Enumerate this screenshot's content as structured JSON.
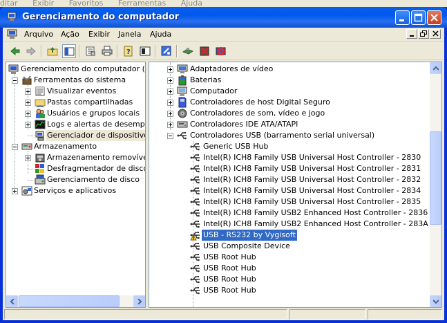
{
  "background_menu": [
    "ditar",
    "Exibir",
    "Favoritos",
    "Ferramentas",
    "Ajuda"
  ],
  "window": {
    "title": "Gerenciamento do computador",
    "colors": {
      "titlebar": "#0058ee",
      "selection": "#316ac5",
      "close": "#c4401f"
    }
  },
  "menubar": {
    "items": [
      "Arquivo",
      "Ação",
      "Exibir",
      "Janela",
      "Ajuda"
    ]
  },
  "toolbar": {
    "icons": [
      "back-arrow-icon",
      "forward-arrow-icon",
      "up-folder-icon",
      "show-tree-icon",
      "properties-icon",
      "print-icon",
      "help-icon",
      "console-icon",
      "scan-hardware-icon",
      "update-driver-icon",
      "uninstall-icon",
      "disable-icon"
    ]
  },
  "left_tree": {
    "items": [
      {
        "label": "Gerenciamento do computador (loca",
        "icon": "computer-management-icon",
        "level": 0,
        "expander": "none"
      },
      {
        "label": "Ferramentas do sistema",
        "icon": "tools-icon",
        "level": 1,
        "expander": "minus"
      },
      {
        "label": "Visualizar eventos",
        "icon": "event-viewer-icon",
        "level": 2,
        "expander": "plus"
      },
      {
        "label": "Pastas compartilhadas",
        "icon": "shared-folder-icon",
        "level": 2,
        "expander": "plus"
      },
      {
        "label": "Usuários e grupos locais",
        "icon": "users-icon",
        "level": 2,
        "expander": "plus"
      },
      {
        "label": "Logs e alertas de desempen",
        "icon": "performance-logs-icon",
        "level": 2,
        "expander": "plus"
      },
      {
        "label": "Gerenciador de dispositivos",
        "icon": "device-manager-icon",
        "level": 2,
        "expander": "none",
        "selected": true
      },
      {
        "label": "Armazenamento",
        "icon": "storage-icon",
        "level": 1,
        "expander": "minus"
      },
      {
        "label": "Armazenamento removível",
        "icon": "removable-storage-icon",
        "level": 2,
        "expander": "plus"
      },
      {
        "label": "Desfragmentador de disco",
        "icon": "defrag-icon",
        "level": 2,
        "expander": "none"
      },
      {
        "label": "Gerenciamento de disco",
        "icon": "disk-management-icon",
        "level": 2,
        "expander": "none"
      },
      {
        "label": "Serviços e aplicativos",
        "icon": "services-icon",
        "level": 1,
        "expander": "plus"
      }
    ]
  },
  "right_tree": {
    "items": [
      {
        "label": "Adaptadores de vídeo",
        "icon": "display-adapter-icon",
        "level": 0,
        "expander": "plus"
      },
      {
        "label": "Baterias",
        "icon": "battery-icon",
        "level": 0,
        "expander": "plus"
      },
      {
        "label": "Computador",
        "icon": "computer-icon",
        "level": 0,
        "expander": "plus"
      },
      {
        "label": "Controladores de host Digital Seguro",
        "icon": "sd-host-icon",
        "level": 0,
        "expander": "plus"
      },
      {
        "label": "Controladores de som, vídeo e jogo",
        "icon": "sound-icon",
        "level": 0,
        "expander": "plus"
      },
      {
        "label": "Controladores IDE ATA/ATAPI",
        "icon": "ide-controller-icon",
        "level": 0,
        "expander": "plus"
      },
      {
        "label": "Controladores USB (barramento serial universal)",
        "icon": "usb-icon",
        "level": 0,
        "expander": "minus"
      },
      {
        "label": "Generic USB Hub",
        "icon": "usb-icon",
        "level": 1
      },
      {
        "label": "Intel(R) ICH8 Family USB Universal Host Controller - 2830",
        "icon": "usb-icon",
        "level": 1
      },
      {
        "label": "Intel(R) ICH8 Family USB Universal Host Controller - 2831",
        "icon": "usb-icon",
        "level": 1
      },
      {
        "label": "Intel(R) ICH8 Family USB Universal Host Controller - 2832",
        "icon": "usb-icon",
        "level": 1
      },
      {
        "label": "Intel(R) ICH8 Family USB Universal Host Controller - 2834",
        "icon": "usb-icon",
        "level": 1
      },
      {
        "label": "Intel(R) ICH8 Family USB Universal Host Controller - 2835",
        "icon": "usb-icon",
        "level": 1
      },
      {
        "label": "Intel(R) ICH8 Family USB2 Enhanced Host Controller - 2836",
        "icon": "usb-icon",
        "level": 1
      },
      {
        "label": "Intel(R) ICH8 Family USB2 Enhanced Host Controller - 283A",
        "icon": "usb-icon",
        "level": 1
      },
      {
        "label": "USB - RS232 by Vygisoft",
        "icon": "usb-warning-icon",
        "level": 1,
        "selected": true
      },
      {
        "label": "USB Composite Device",
        "icon": "usb-icon",
        "level": 1
      },
      {
        "label": "USB Root Hub",
        "icon": "usb-icon",
        "level": 1
      },
      {
        "label": "USB Root Hub",
        "icon": "usb-icon",
        "level": 1
      },
      {
        "label": "USB Root Hub",
        "icon": "usb-icon",
        "level": 1
      },
      {
        "label": "USB Root Hub",
        "icon": "usb-icon",
        "level": 1
      }
    ]
  },
  "statusbar": {
    "text": ""
  }
}
